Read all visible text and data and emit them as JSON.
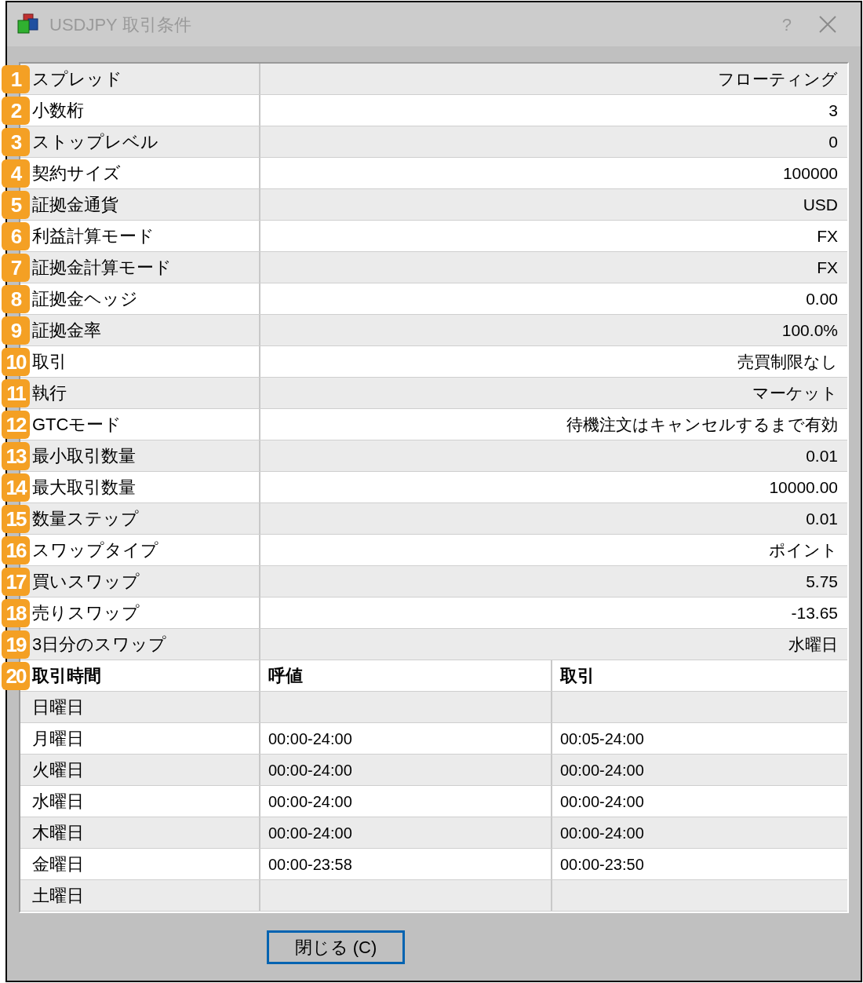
{
  "window": {
    "title": "USDJPY 取引条件",
    "help": "?"
  },
  "properties": [
    {
      "badge": "1",
      "label": "スプレッド",
      "value": "フローティング"
    },
    {
      "badge": "2",
      "label": "小数桁",
      "value": "3"
    },
    {
      "badge": "3",
      "label": "ストップレベル",
      "value": "0"
    },
    {
      "badge": "4",
      "label": "契約サイズ",
      "value": "100000"
    },
    {
      "badge": "5",
      "label": "証拠金通貨",
      "value": "USD"
    },
    {
      "badge": "6",
      "label": "利益計算モード",
      "value": "FX"
    },
    {
      "badge": "7",
      "label": "証拠金計算モード",
      "value": "FX"
    },
    {
      "badge": "8",
      "label": "証拠金ヘッジ",
      "value": "0.00"
    },
    {
      "badge": "9",
      "label": "証拠金率",
      "value": "100.0%"
    },
    {
      "badge": "10",
      "label": "取引",
      "value": "売買制限なし"
    },
    {
      "badge": "11",
      "label": "執行",
      "value": "マーケット"
    },
    {
      "badge": "12",
      "label": "GTCモード",
      "value": "待機注文はキャンセルするまで有効"
    },
    {
      "badge": "13",
      "label": "最小取引数量",
      "value": "0.01"
    },
    {
      "badge": "14",
      "label": "最大取引数量",
      "value": "10000.00"
    },
    {
      "badge": "15",
      "label": "数量ステップ",
      "value": "0.01"
    },
    {
      "badge": "16",
      "label": "スワップタイプ",
      "value": "ポイント"
    },
    {
      "badge": "17",
      "label": "買いスワップ",
      "value": "5.75"
    },
    {
      "badge": "18",
      "label": "売りスワップ",
      "value": "-13.65"
    },
    {
      "badge": "19",
      "label": "3日分のスワップ",
      "value": "水曜日"
    }
  ],
  "schedule": {
    "badge": "20",
    "columns": [
      "取引時間",
      "呼値",
      "取引"
    ],
    "rows": [
      [
        "日曜日"
      ],
      [
        "月曜日",
        "00:00-24:00",
        "00:05-24:00"
      ],
      [
        "火曜日",
        "00:00-24:00",
        "00:00-24:00"
      ],
      [
        "水曜日",
        "00:00-24:00",
        "00:00-24:00"
      ],
      [
        "木曜日",
        "00:00-24:00",
        "00:00-24:00"
      ],
      [
        "金曜日",
        "00:00-23:58",
        "00:00-23:50"
      ],
      [
        "土曜日"
      ]
    ]
  },
  "buttons": [
    {
      "label": "閉じる (C)",
      "focused": true
    }
  ]
}
